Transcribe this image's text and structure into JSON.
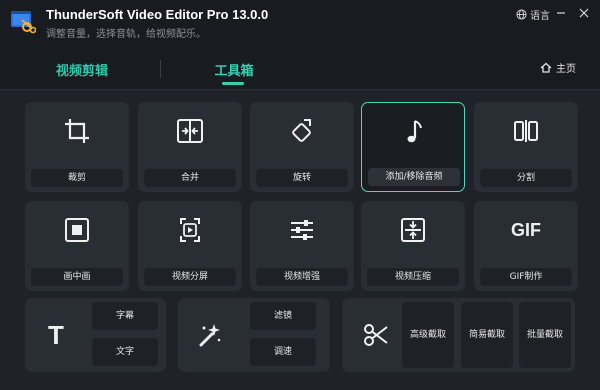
{
  "app": {
    "title": "ThunderSoft Video Editor Pro 13.0.0",
    "subtitle": "调整音量，选择音轨，给视频配乐。",
    "language_label": "语言"
  },
  "tabs": [
    {
      "label": "视频剪辑",
      "active": false
    },
    {
      "label": "工具箱",
      "active": true
    }
  ],
  "home_label": "主页",
  "tools_row1": [
    {
      "label": "裁剪",
      "icon": "crop-icon"
    },
    {
      "label": "合并",
      "icon": "merge-icon"
    },
    {
      "label": "旋转",
      "icon": "rotate-icon"
    },
    {
      "label": "添加/移除音频",
      "icon": "music-note-icon",
      "selected": true
    },
    {
      "label": "分割",
      "icon": "split-icon"
    }
  ],
  "tools_row2": [
    {
      "label": "画中画",
      "icon": "picture-in-picture-icon"
    },
    {
      "label": "视频分屏",
      "icon": "split-screen-icon"
    },
    {
      "label": "视频增强",
      "icon": "sliders-icon"
    },
    {
      "label": "视频压缩",
      "icon": "compress-icon"
    },
    {
      "label": "GIF制作",
      "icon": "gif-icon",
      "icon_text": "GIF"
    }
  ],
  "bottom_groups": {
    "text_group": {
      "icon_text": "T",
      "buttons": [
        "字幕",
        "文字"
      ]
    },
    "effects_group": {
      "icon": "magic-wand-icon",
      "buttons": [
        "滤镜",
        "调速"
      ]
    },
    "cut_group": {
      "icon": "scissors-icon",
      "buttons": [
        "高级截取",
        "简易截取",
        "批量截取"
      ]
    }
  },
  "colors": {
    "accent": "#37d1b2",
    "background": "#1f2329",
    "card": "#292e35",
    "titlebar": "#181b20"
  }
}
